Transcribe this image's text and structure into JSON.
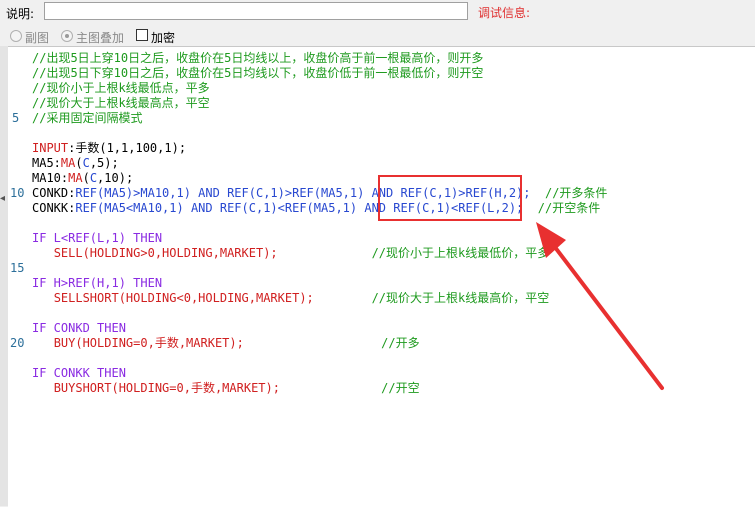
{
  "toolbar": {
    "desc_label": "说明:",
    "desc_value": "",
    "debug_label": "调试信息:"
  },
  "options": {
    "sub_chart_label": "副图",
    "main_overlay_label": "主图叠加",
    "encrypt_label": "加密"
  },
  "gutter_numbers": {
    "n5": "5",
    "n10": "10",
    "n15": "15",
    "n20": "20"
  },
  "code": {
    "c1": "//出现5日上穿10日之后，收盘价在5日均线以上，收盘价高于前一根最高价，则开多",
    "c2": "//出现5日下穿10日之后，收盘价在5日均线以下，收盘价低于前一根最低价，则开空",
    "c3": "//现价小于上根k线最低点，平多",
    "c4": "//现价大于上根k线最高点，平空",
    "c5": "//采用固定间隔模式",
    "input_kw": "INPUT",
    "input_rest": ":手数(1,1,100,1);",
    "ma5_a": "MA5:",
    "ma5_f": "MA",
    "ma5_b": "(",
    "ma5_v": "C",
    "ma5_c": ",5);",
    "ma10_a": "MA10:",
    "ma10_f": "MA",
    "ma10_b": "(",
    "ma10_v": "C",
    "ma10_c": ",10);",
    "conkd_pre": "CONKD:",
    "conkd_cond": "REF(MA5)>MA10,1) AND REF(C,1)>REF(MA5,1) AND REF(C,1)>REF(H,2);",
    "conkd_cmt": "//开多条件",
    "conkk_pre": "CONKK:",
    "conkk_cond": "REF(MA5<MA10,1) AND REF(C,1)<REF(MA5,1) AND REF(C,1)<REF(L,2);",
    "conkk_cmt": "//开空条件",
    "if1": "IF L<REF(L,1) THEN",
    "sell": "SELL(HOLDING>0,HOLDING,MARKET);",
    "sell_cmt": "//现价小于上根k线最低价，平多",
    "if2": "IF H>REF(H,1) THEN",
    "sellshort": "SELLSHORT(HOLDING<0,HOLDING,MARKET);",
    "sellshort_cmt": "//现价大于上根k线最高价，平空",
    "if3": "IF CONKD THEN",
    "buy": "BUY(HOLDING=0,手数,MARKET);",
    "buy_cmt": "//开多",
    "if4": "IF CONKK THEN",
    "buyshort": "BUYSHORT(HOLDING=0,手数,MARKET);",
    "buyshort_cmt": "//开空"
  },
  "colors": {
    "comment": "#1e9a1e",
    "keyword": "#8a2be2",
    "function": "#d02020",
    "variable": "#2848d0",
    "annotation": "#e83030"
  }
}
